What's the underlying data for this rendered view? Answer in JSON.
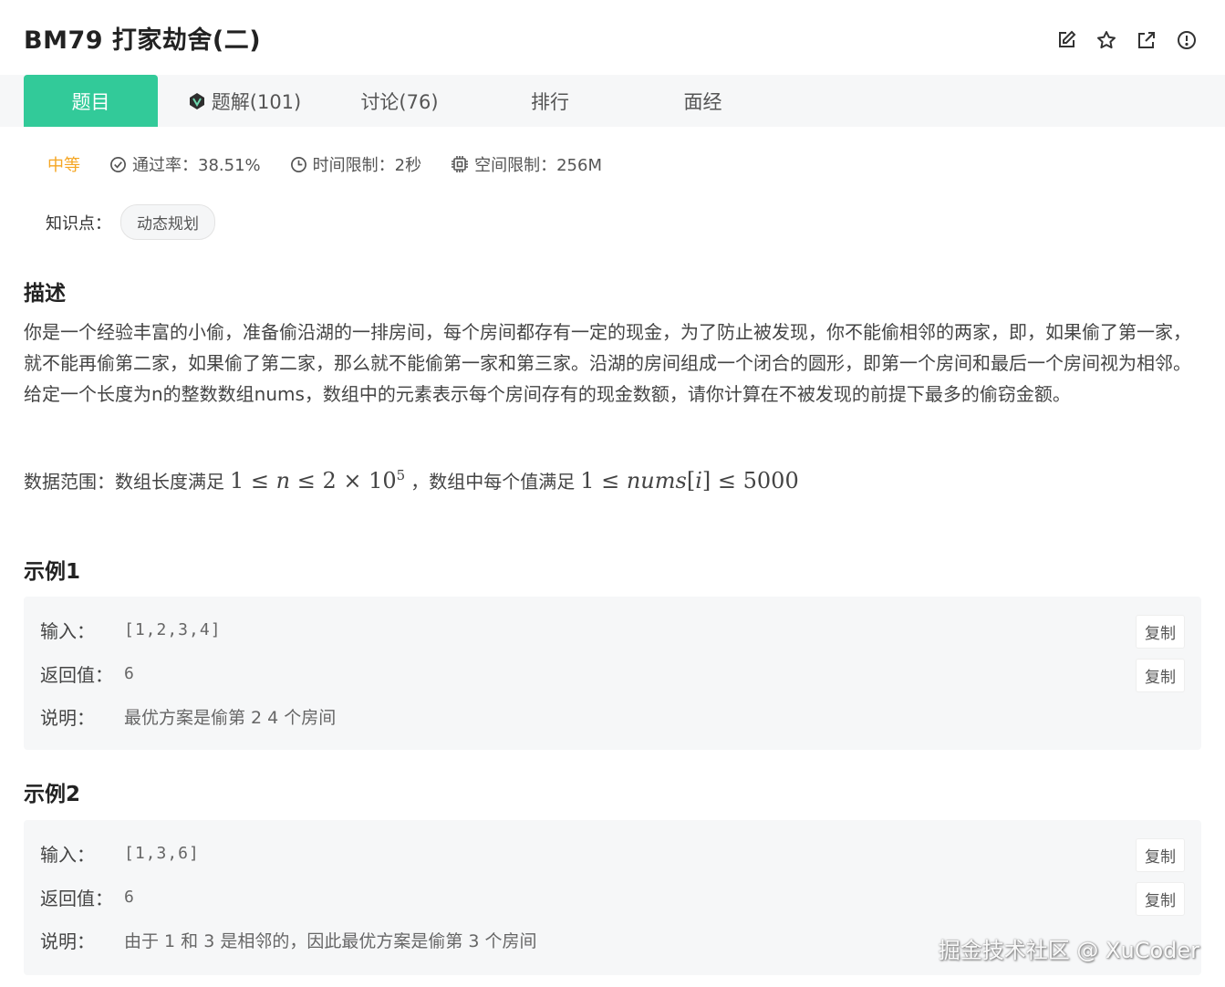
{
  "header": {
    "title": "BM79  打家劫舍(二)",
    "icons": [
      "edit-icon",
      "star-icon",
      "external-link-icon",
      "alert-icon"
    ]
  },
  "tabs": [
    {
      "label": "题目",
      "active": true
    },
    {
      "label": "题解(101)",
      "icon": "v-badge-icon"
    },
    {
      "label": "讨论(76)"
    },
    {
      "label": "排行"
    },
    {
      "label": "面经"
    }
  ],
  "meta": {
    "difficulty": "中等",
    "pass_rate": "通过率：38.51%",
    "time_limit": "时间限制：2秒",
    "space_limit": "空间限制：256M"
  },
  "knowledge": {
    "label": "知识点：",
    "tag": "动态规划"
  },
  "description": {
    "title": "描述",
    "line1": "你是一个经验丰富的小偷，准备偷沿湖的一排房间，每个房间都存有一定的现金，为了防止被发现，你不能偷相邻的两家，即，如果偷了第一家，就不能再偷第二家，如果偷了第二家，那么就不能偷第一家和第三家。沿湖的房间组成一个闭合的圆形，即第一个房间和最后一个房间视为相邻。",
    "line2": "给定一个长度为n的整数数组nums，数组中的元素表示每个房间存有的现金数额，请你计算在不被发现的前提下最多的偷窃金额。",
    "range_prefix": "数据范围：数组长度满足",
    "range_mid": "，数组中每个值满足",
    "math1_a": "1 ≤ ",
    "math1_n": "n",
    "math1_b": " ≤ 2 × 10",
    "math1_exp": "5",
    "math2_a": "1 ≤ ",
    "math2_nums": "nums",
    "math2_b": "[",
    "math2_i": "i",
    "math2_c": "] ≤ 5000"
  },
  "examples": [
    {
      "title": "示例1",
      "input_label": "输入：",
      "input": "[1,2,3,4]",
      "return_label": "返回值：",
      "return": "6",
      "explain_label": "说明：",
      "explain": "最优方案是偷第 2 4 个房间",
      "copy": "复制"
    },
    {
      "title": "示例2",
      "input_label": "输入：",
      "input": "[1,3,6]",
      "return_label": "返回值：",
      "return": "6",
      "explain_label": "说明：",
      "explain": "由于 1 和 3 是相邻的，因此最优方案是偷第 3 个房间",
      "copy": "复制"
    }
  ],
  "watermark": "掘金技术社区 @ XuCoder",
  "colors": {
    "accent": "#32ca99",
    "difficulty": "#f5a623"
  }
}
